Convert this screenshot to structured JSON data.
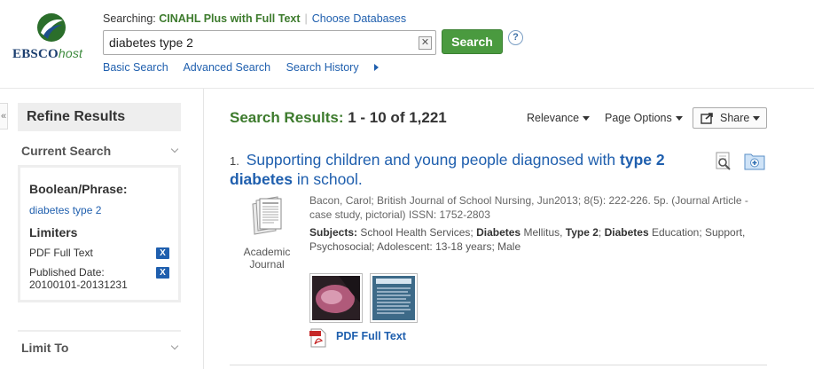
{
  "logo": {
    "brand": "EBSCO",
    "host": "host"
  },
  "header": {
    "searching_label": "Searching:",
    "database": "CINAHL Plus with Full Text",
    "choose_databases": "Choose Databases",
    "query": "diabetes type 2",
    "search_button": "Search",
    "help": "?",
    "clear": "✕",
    "nav": {
      "basic": "Basic Search",
      "advanced": "Advanced Search",
      "history": "Search History"
    }
  },
  "sidebar": {
    "collapse": "«",
    "title": "Refine Results",
    "current_search_heading": "Current Search",
    "boolean_label": "Boolean/Phrase:",
    "boolean_term": "diabetes type 2",
    "limiters_label": "Limiters",
    "limiters": [
      {
        "label": "PDF Full Text",
        "remove": "X"
      },
      {
        "label": "Published Date:",
        "value": "20100101-20131231",
        "remove": "X"
      }
    ],
    "limit_to_heading": "Limit To"
  },
  "results": {
    "heading": "Search Results:",
    "range": "1 - 10 of 1,221",
    "sort": "Relevance",
    "page_options": "Page Options",
    "share": "Share",
    "items": [
      {
        "number": "1.",
        "title_pre": "Supporting children and young people diagnosed with ",
        "title_bold1": "type 2",
        "title_bold2": "diabetes",
        "title_post": " in school.",
        "pub_type_line1": "Academic",
        "pub_type_line2": "Journal",
        "citation": "Bacon, Carol; British Journal of School Nursing, Jun2013; 8(5): 222-226. 5p. (Journal Article - case study, pictorial) ISSN: 1752-2803",
        "subjects_label": "Subjects:",
        "subjects_1": " School Health Services; ",
        "subjects_b1": "Diabetes",
        "subjects_2": " Mellitus, ",
        "subjects_b2": "Type 2",
        "subjects_3": "; ",
        "subjects_b3": "Diabetes",
        "subjects_4": " Education; Support, Psychosocial; Adolescent: 13-18 years; Male",
        "full_text": "PDF Full Text"
      }
    ]
  },
  "colors": {
    "green": "#3d7b2d",
    "link": "#1f5fae",
    "button": "#4a9a3f"
  }
}
